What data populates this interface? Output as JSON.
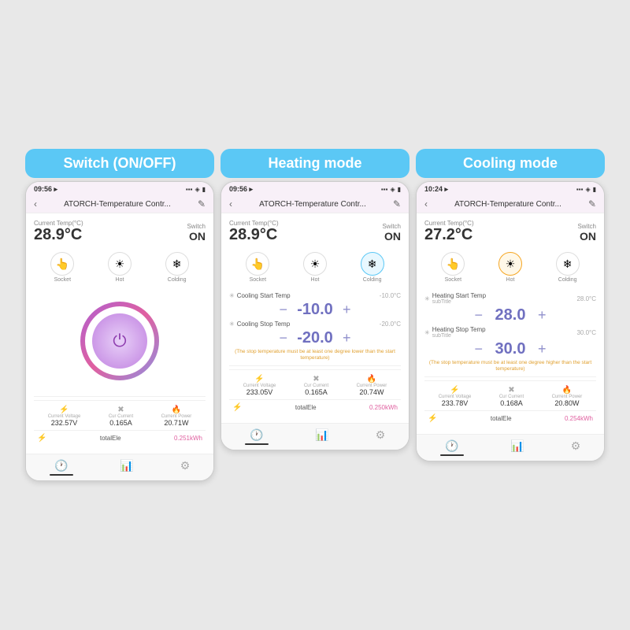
{
  "cards": [
    {
      "id": "switch",
      "label": "Switch (ON/OFF)",
      "time": "09:56",
      "signal": "◀",
      "title": "ATORCH-Temperature Contr...",
      "current_temp_label": "Current Temp(°C)",
      "current_temp": "28.9°C",
      "switch_label": "Switch",
      "switch_val": "ON",
      "modes": [
        {
          "icon": "👆",
          "label": "Socket",
          "active": false
        },
        {
          "icon": "☀",
          "label": "Hot",
          "active": false
        },
        {
          "icon": "❄",
          "label": "Colding",
          "active": false
        }
      ],
      "show_power": true,
      "settings": [],
      "stats": [
        {
          "icon": "⚡",
          "label": "Current Voltage",
          "val": "232.57V"
        },
        {
          "icon": "✖",
          "label": "Cur Current",
          "val": "0.165A"
        },
        {
          "icon": "🔥",
          "label": "Current Power",
          "val": "20.71W"
        }
      ],
      "total_label": "totalEle",
      "total_val": "0.251kWh"
    },
    {
      "id": "heating",
      "label": "Heating mode",
      "time": "09:56",
      "title": "ATORCH-Temperature Contr...",
      "current_temp_label": "Current Temp(°C)",
      "current_temp": "28.9°C",
      "switch_label": "Switch",
      "switch_val": "ON",
      "modes": [
        {
          "icon": "👆",
          "label": "Socket",
          "active": false
        },
        {
          "icon": "☀",
          "label": "Hot",
          "active": false
        },
        {
          "icon": "❄",
          "label": "Colding",
          "active": true,
          "color": "blue"
        }
      ],
      "show_power": false,
      "settings": [
        {
          "name": "Cooling Start Temp",
          "subtitle": "",
          "side_val": "-10.0°C",
          "ctrl_val": "-10.0"
        },
        {
          "name": "Cooling Stop Temp",
          "subtitle": "",
          "side_val": "-20.0°C",
          "ctrl_val": "-20.0"
        }
      ],
      "warning": "(The stop temperature must be at least one degree lower\nthan the start temperature)",
      "stats": [
        {
          "icon": "⚡",
          "label": "Current Voltage",
          "val": "233.05V"
        },
        {
          "icon": "✖",
          "label": "Cur Current",
          "val": "0.165A"
        },
        {
          "icon": "🔥",
          "label": "Current Power",
          "val": "20.74W"
        }
      ],
      "total_label": "totalEle",
      "total_val": "0.250kWh"
    },
    {
      "id": "cooling",
      "label": "Cooling mode",
      "time": "10:24",
      "title": "ATORCH-Temperature Contr...",
      "current_temp_label": "Current Temp(°C)",
      "current_temp": "27.2°C",
      "switch_label": "Switch",
      "switch_val": "ON",
      "modes": [
        {
          "icon": "👆",
          "label": "Socket",
          "active": false
        },
        {
          "icon": "☀",
          "label": "Hot",
          "active": true,
          "color": "orange"
        },
        {
          "icon": "❄",
          "label": "Colding",
          "active": false
        }
      ],
      "show_power": false,
      "settings": [
        {
          "name": "Heating Start Temp",
          "subtitle": "subTitle",
          "side_val": "28.0°C",
          "ctrl_val": "28.0"
        },
        {
          "name": "Heating Stop Temp",
          "subtitle": "subTitle",
          "side_val": "30.0°C",
          "ctrl_val": "30.0"
        }
      ],
      "warning": "(The stop temperature must be at least one degree higher\nthan the start temperature)",
      "stats": [
        {
          "icon": "⚡",
          "label": "Current Voltage",
          "val": "233.78V"
        },
        {
          "icon": "✖",
          "label": "Cur Current",
          "val": "0.168A"
        },
        {
          "icon": "🔥",
          "label": "Current Power",
          "val": "20.80W"
        }
      ],
      "total_label": "totalEle",
      "total_val": "0.254kWh"
    }
  ],
  "bottom_nav": [
    "🕐",
    "📊",
    "⚙"
  ]
}
